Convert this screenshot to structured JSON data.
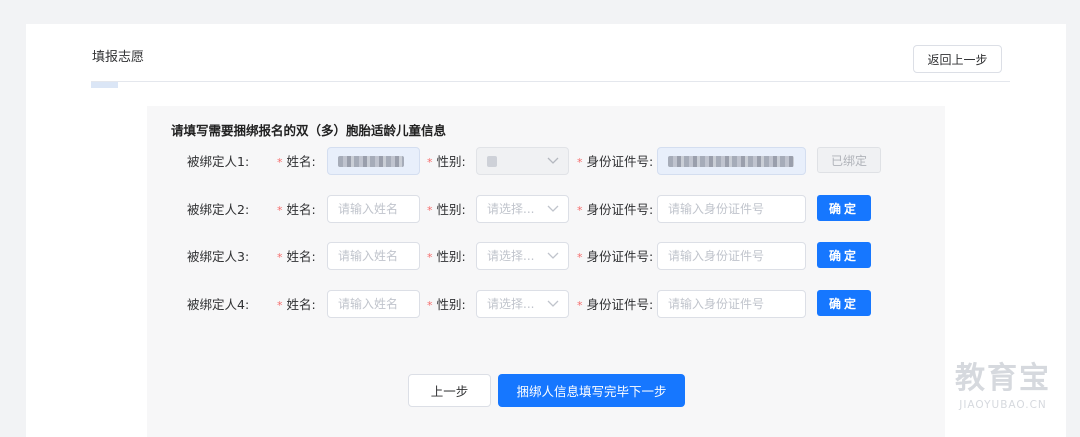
{
  "header": {
    "title": "填报志愿",
    "back_button": "返回上一步"
  },
  "section": {
    "title": "请填写需要捆绑报名的双（多）胞胎适龄儿童信息"
  },
  "labels": {
    "name": "姓名:",
    "gender": "性别:",
    "id_number": "身份证件号:",
    "required_mark": "*"
  },
  "rows": [
    {
      "person_label": "被绑定人1:",
      "name_placeholder": "",
      "gender_placeholder": "",
      "id_placeholder": "",
      "action_label": "已绑定",
      "state": "bound"
    },
    {
      "person_label": "被绑定人2:",
      "name_placeholder": "请输入姓名",
      "gender_placeholder": "请选择...",
      "id_placeholder": "请输入身份证件号",
      "action_label": "确定",
      "state": "editable"
    },
    {
      "person_label": "被绑定人3:",
      "name_placeholder": "请输入姓名",
      "gender_placeholder": "请选择...",
      "id_placeholder": "请输入身份证件号",
      "action_label": "确定",
      "state": "editable"
    },
    {
      "person_label": "被绑定人4:",
      "name_placeholder": "请输入姓名",
      "gender_placeholder": "请选择...",
      "id_placeholder": "请输入身份证件号",
      "action_label": "确定",
      "state": "editable"
    }
  ],
  "footer": {
    "prev_button": "上一步",
    "next_button": "捆绑人信息填写完毕下一步"
  },
  "watermark": {
    "main": "教育宝",
    "sub": "JIAOYUBAO.CN"
  },
  "colors": {
    "primary": "#1677ff",
    "required": "#f56c6c",
    "panel_bg": "#f7f7f8"
  }
}
